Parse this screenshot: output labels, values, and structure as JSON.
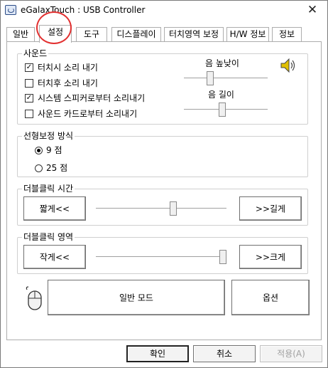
{
  "window": {
    "title": "eGalaxTouch : USB Controller",
    "close_glyph": "✕",
    "icon": "usb-controller-icon"
  },
  "tabs": [
    {
      "label": "일반"
    },
    {
      "label": "설정",
      "active": true
    },
    {
      "label": "도구"
    },
    {
      "label": "디스플레이"
    },
    {
      "label": "터치영역 보정"
    },
    {
      "label": "H/W 정보"
    },
    {
      "label": "정보"
    }
  ],
  "sound": {
    "legend": "사운드",
    "options": [
      {
        "label": "터치시 소리 내기",
        "checked": true
      },
      {
        "label": "터치후 소리 내기",
        "checked": false
      },
      {
        "label": "시스템 스피커로부터 소리내기",
        "checked": true
      },
      {
        "label": "사운드 카드로부터 소리내기",
        "checked": false
      }
    ],
    "check_glyph": "✓",
    "volume_label": "음 높낮이",
    "volume_level": 0.3,
    "length_label": "음 길이",
    "length_level": 0.45,
    "icon": "speaker-icon"
  },
  "linearization": {
    "legend": "선형보정 방식",
    "options": [
      {
        "label": "9 점",
        "selected": true
      },
      {
        "label": "25 점",
        "selected": false
      }
    ]
  },
  "double_click_time": {
    "legend": "더블클릭 시간",
    "shorter_label": "짧게<<",
    "longer_label": ">>길게",
    "level": 0.6
  },
  "double_click_area": {
    "legend": "더블클릭 영역",
    "smaller_label": "작게<<",
    "larger_label": ">>크게",
    "level": 1.0
  },
  "mode": {
    "icon": "mouse-icon",
    "mode_button_label": "일반 모드",
    "options_button_label": "옵션"
  },
  "footer": {
    "ok_label": "확인",
    "cancel_label": "취소",
    "apply_label": "적용(A)"
  },
  "colors": {
    "annotation": "#e23030",
    "speaker": "#e0c000"
  }
}
